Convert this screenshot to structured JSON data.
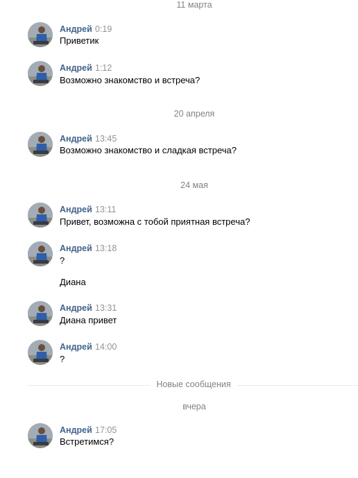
{
  "dates": [
    "11 марта",
    "20 апреля",
    "24 мая",
    "вчера"
  ],
  "new_messages_label": "Новые сообщения",
  "author": "Андрей",
  "messages": [
    {
      "time": "0:19",
      "lines": [
        "Приветик"
      ]
    },
    {
      "time": "1:12",
      "lines": [
        "Возможно знакомство и встреча?"
      ]
    },
    {
      "time": "13:45",
      "lines": [
        "Возможно знакомство и сладкая встреча?"
      ]
    },
    {
      "time": "13:11",
      "lines": [
        "Привет, возможна с тобой приятная встреча?"
      ]
    },
    {
      "time": "13:18",
      "lines": [
        "?",
        "Диана"
      ]
    },
    {
      "time": "13:31",
      "lines": [
        "Диана привет"
      ]
    },
    {
      "time": "14:00",
      "lines": [
        "?"
      ]
    },
    {
      "time": "17:05",
      "lines": [
        "Встретимся?"
      ]
    }
  ],
  "colors": {
    "author": "#42648b",
    "time": "#939393",
    "date": "#828282",
    "divider": "#e7e8ec"
  }
}
